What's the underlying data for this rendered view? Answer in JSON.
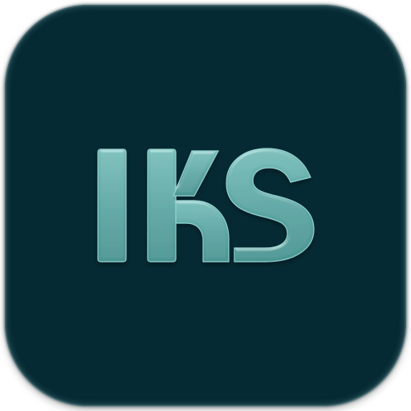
{
  "icon": {
    "logo_text": "IKS",
    "background_color": "#052a33",
    "logo_color": "#5ba6a3",
    "logo_highlight": "#8fd0cc",
    "logo_shadow": "#2f6f6d",
    "icon_name": "iks-logo-icon"
  }
}
